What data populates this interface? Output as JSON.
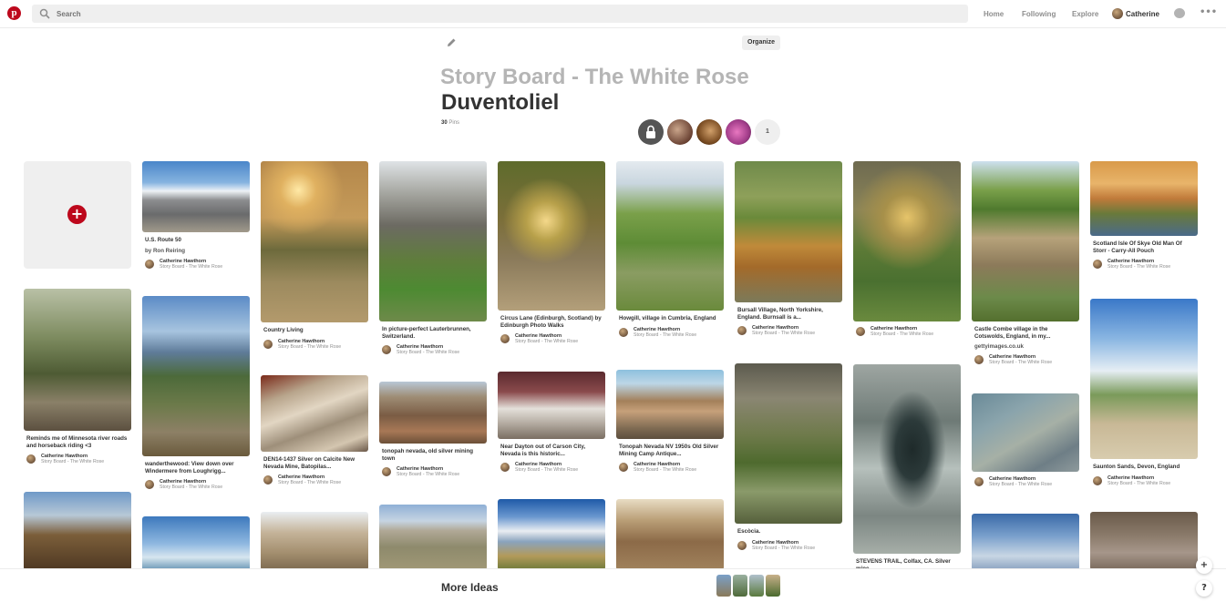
{
  "app": {
    "brand_color": "#bd081c",
    "logo_letter": "p",
    "logo_icon": "pinterest-logo"
  },
  "header": {
    "search_placeholder": "Search",
    "nav": [
      "Home",
      "Following",
      "Explore"
    ],
    "user_name": "Catherine"
  },
  "board": {
    "title": "Story Board - The White Rose",
    "section": "Duventoliel",
    "pin_count": "30",
    "pin_label": "Pins",
    "organize_label": "Organize",
    "collaborators_extra": "1"
  },
  "pin_owner": {
    "name": "Catherine Hawthorn",
    "board": "Story Board - The White Rose"
  },
  "pins": [
    {
      "id": "p1",
      "desc": "Reminds me of Minnesota river roads and horseback riding <3",
      "src": ""
    },
    {
      "id": "p2",
      "desc": "U.S. Route 50",
      "src": "by Ron Reiring"
    },
    {
      "id": "p3",
      "desc": "wanderthewood: View down over Windermere from Loughrigg...",
      "src": ""
    },
    {
      "id": "p4",
      "desc": "Country Living",
      "src": ""
    },
    {
      "id": "p5",
      "desc": "DEN14-1437 Silver on Calcite New Nevada Mine, Batopilas...",
      "src": ""
    },
    {
      "id": "p6",
      "desc": "In picture-perfect Lauterbrunnen, Switzerland.",
      "src": ""
    },
    {
      "id": "p7",
      "desc": "tonopah nevada, old silver mining town",
      "src": ""
    },
    {
      "id": "p8",
      "desc": "Circus Lane (Edinburgh, Scotland) by Edinburgh Photo Walks",
      "src": ""
    },
    {
      "id": "p9",
      "desc": "Near Dayton out of Carson City, Nevada is this historic...",
      "src": ""
    },
    {
      "id": "p10",
      "desc": "Howgill, village in Cumbria, England",
      "src": ""
    },
    {
      "id": "p11",
      "desc": "Tonopah Nevada NV 1950s Old Silver Mining Camp Antique...",
      "src": ""
    },
    {
      "id": "p12",
      "desc": "Bursall Village, North Yorkshire, England. Burnsall is a...",
      "src": ""
    },
    {
      "id": "p13",
      "desc": "Escòcia.",
      "src": ""
    },
    {
      "id": "p14",
      "desc": "",
      "src": ""
    },
    {
      "id": "p15",
      "desc": "STEVENS TRAIL, Colfax, CA. Silver mine",
      "src": ""
    },
    {
      "id": "p16",
      "desc": "Castle Combe village in the Cotswolds, England, in my...",
      "src": "gettyimages.co.uk"
    },
    {
      "id": "p17",
      "desc": "",
      "src": ""
    },
    {
      "id": "p18",
      "desc": "Scotland Isle Of Skye Old Man Of Storr - Carry-All Pouch",
      "src": ""
    },
    {
      "id": "p19",
      "desc": "Saunton Sands, Devon, England",
      "src": ""
    }
  ],
  "footer": {
    "more_ideas": "More Ideas",
    "help": "?",
    "plus": "+"
  }
}
